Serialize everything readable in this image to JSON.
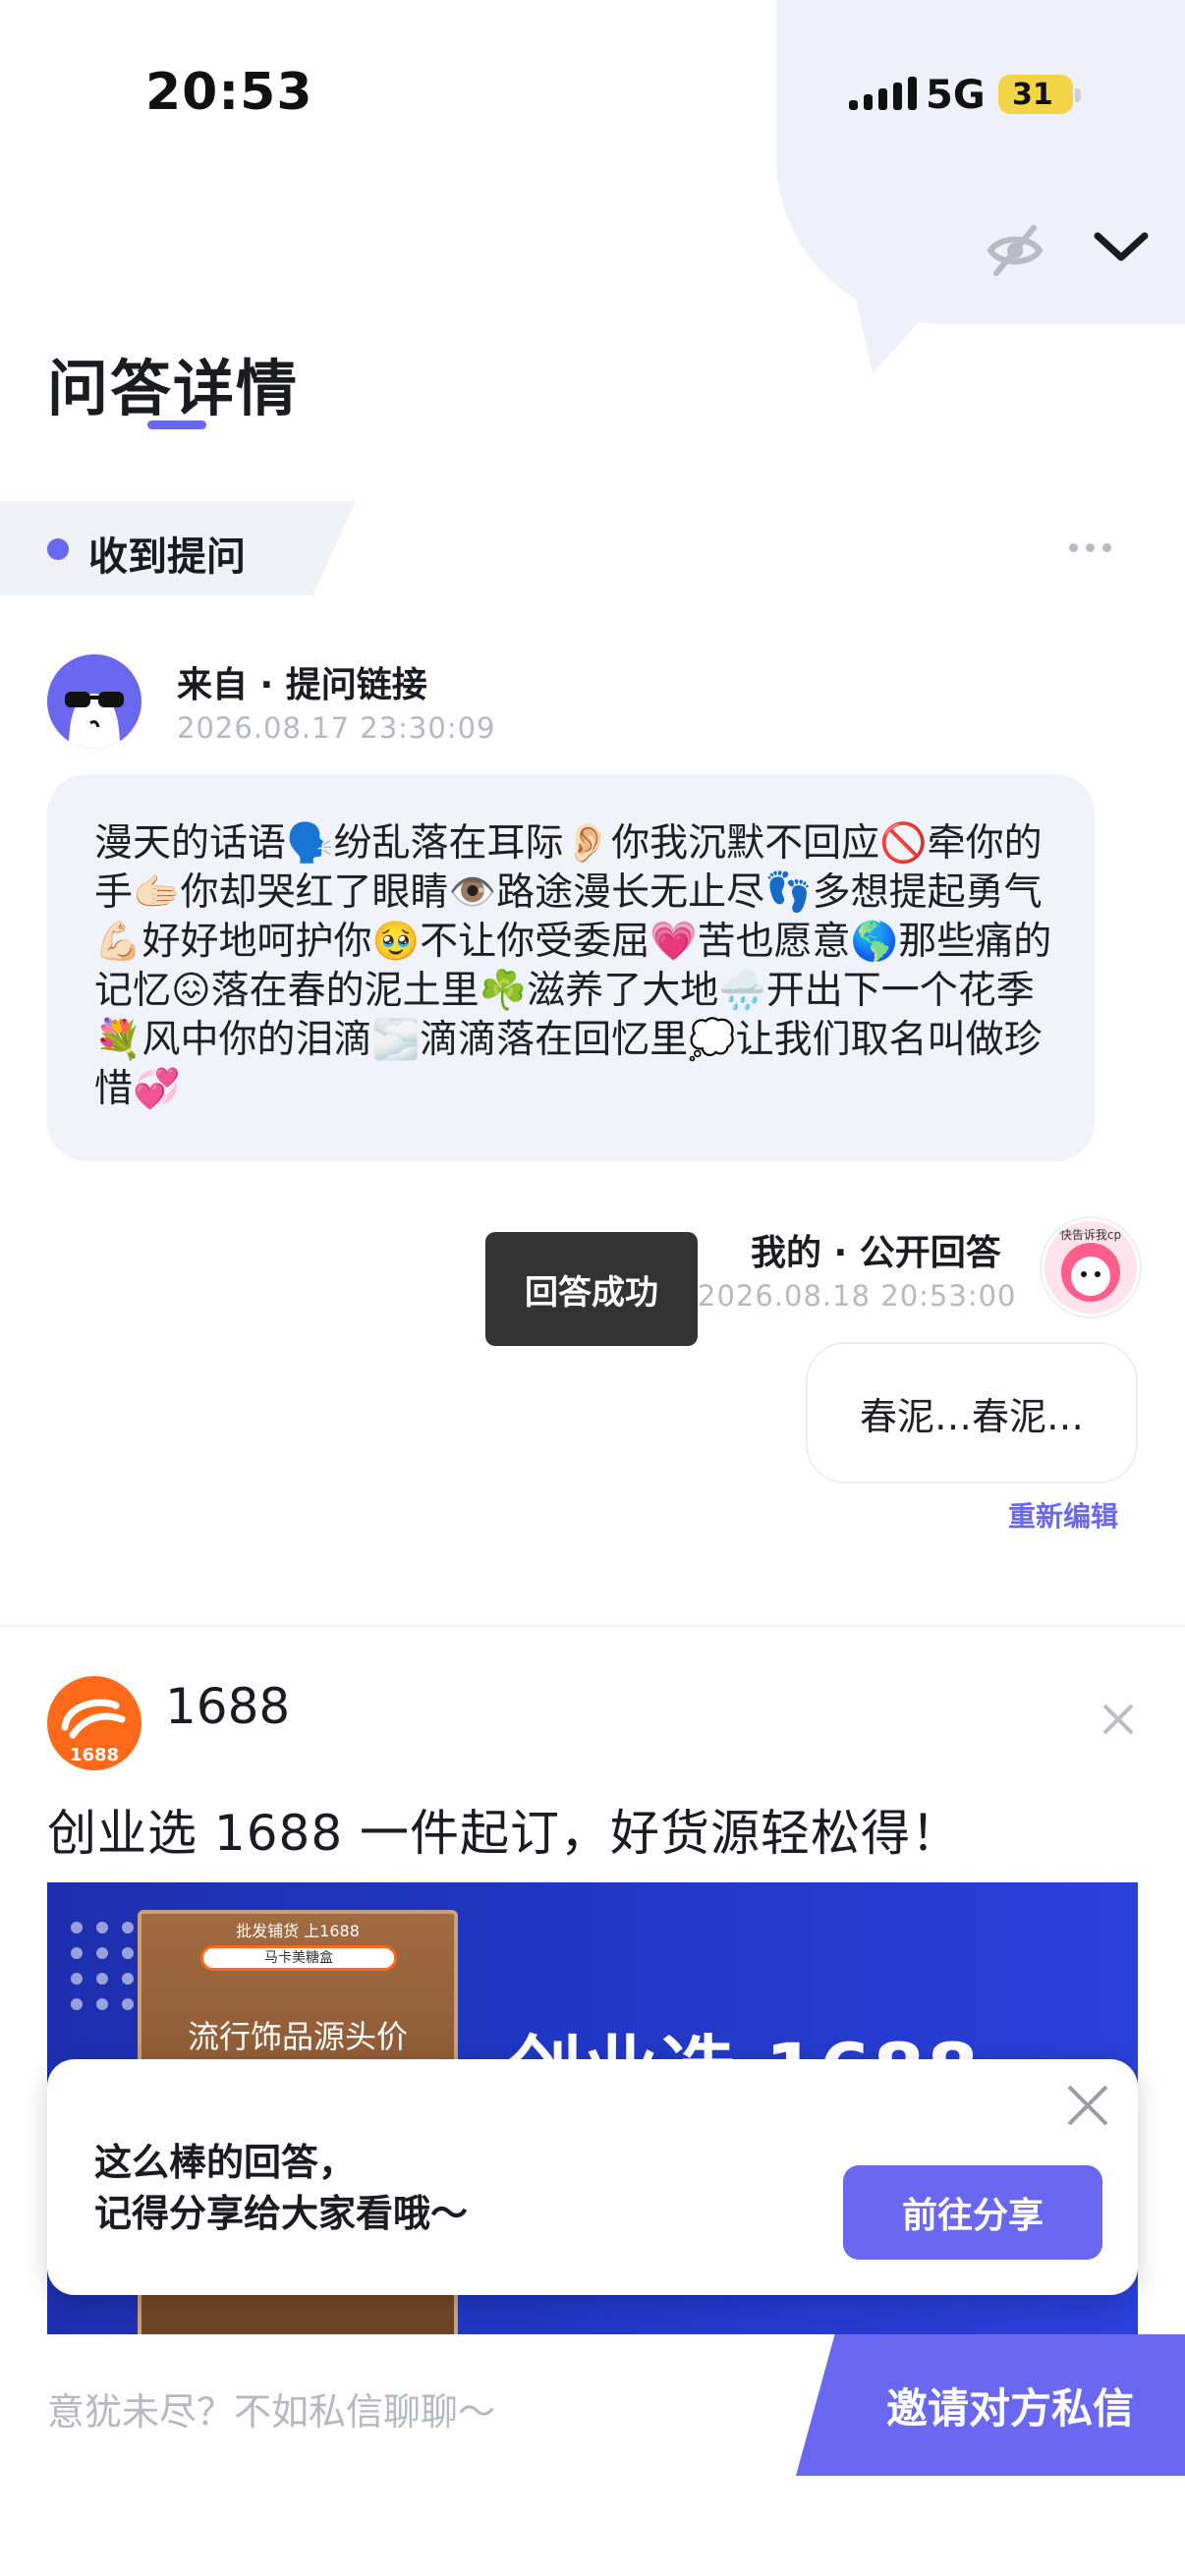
{
  "status_bar": {
    "time": "20:53",
    "network": "5G",
    "battery": "31"
  },
  "header": {
    "title": "问答详情",
    "icons": [
      "eye-off-icon",
      "chevron-down-icon"
    ]
  },
  "section": {
    "label": "收到提问"
  },
  "question": {
    "source": "来自 · 提问链接",
    "time": "2026.08.17 23:30:09",
    "text": "漫天的话语🗣️纷乱落在耳际👂🏻你我沉默不回应🚫牵你的手🫱🏻你却哭红了眼睛👁️路途漫长无止尽👣多想提起勇气💪🏻好好地呵护你🥹不让你受委屈💗苦也愿意🌎那些痛的记忆😖落在春的泥土里☘️滋养了大地🌧️开出下一个花季💐风中你的泪滴🌫️滴滴落在回忆里💭让我们取名叫做珍惜💞"
  },
  "answer": {
    "toast": "回答成功",
    "label": "我的 · 公开回答",
    "time": "2026.08.18 20:53:00",
    "avatar_text": "快告诉我cp",
    "text": "春泥…春泥…",
    "reedit": "重新编辑"
  },
  "ad": {
    "logo_text": "1688",
    "brand": "1688",
    "title": "创业选 1688 一件起订，好货源轻松得！",
    "banner_text": "创业选 1688一",
    "product_top": "批发铺货 上1688",
    "product_search": "马卡美糖盒",
    "product_tag": "流行饰品源头价"
  },
  "share_card": {
    "line1": "这么棒的回答，",
    "line2": "记得分享给大家看哦～",
    "button": "前往分享"
  },
  "bottom": {
    "hint": "意犹未尽？不如私信聊聊～",
    "invite": "邀请对方私信"
  },
  "colors": {
    "accent": "#6a67f0",
    "card_bg": "#f1f3fa",
    "ad_orange": "#ff6a1a",
    "ad_blue": "#2138c8"
  }
}
